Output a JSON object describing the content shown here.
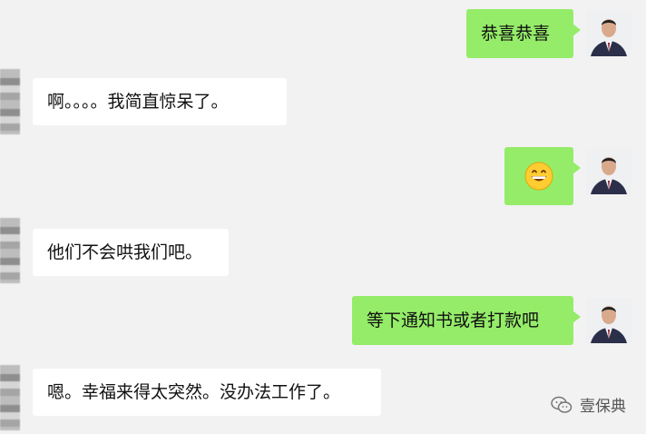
{
  "messages": [
    {
      "side": "out",
      "text": "恭喜恭喜"
    },
    {
      "side": "in",
      "text": "啊。。。。我简直惊呆了。"
    },
    {
      "side": "out",
      "emoji": "grinning-face-emoji"
    },
    {
      "side": "in",
      "text": "他们不会哄我们吧。"
    },
    {
      "side": "out",
      "text": "等下通知书或者打款吧"
    },
    {
      "side": "in",
      "text": "嗯。幸福来得太突然。没办法工作了。"
    }
  ],
  "watermark": {
    "icon": "wechat-icon",
    "text": "壹保典"
  },
  "colors": {
    "background": "#f2f2f2",
    "outgoing_bubble": "#95ec69",
    "incoming_bubble": "#ffffff"
  }
}
